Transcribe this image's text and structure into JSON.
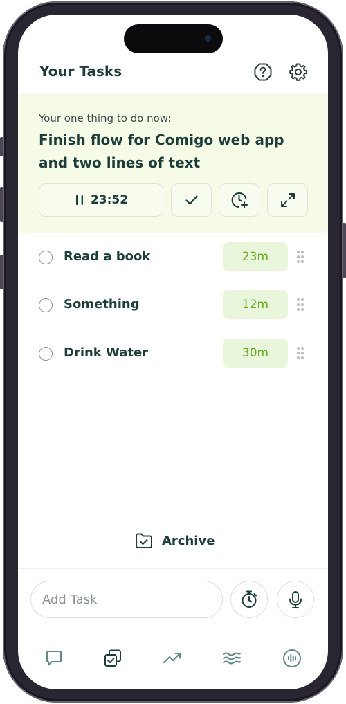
{
  "header": {
    "title": "Your Tasks"
  },
  "focus": {
    "label": "Your one thing to do now:",
    "title": "Finish flow for Comigo web app and two lines of text",
    "timer": "23:52"
  },
  "tasks": [
    {
      "label": "Read a book",
      "duration": "23m"
    },
    {
      "label": "Something",
      "duration": "12m"
    },
    {
      "label": "Drink Water",
      "duration": "30m"
    }
  ],
  "archive": {
    "label": "Archive"
  },
  "add_task": {
    "placeholder": "Add Task"
  },
  "colors": {
    "accent": "#63ab19",
    "text": "#1e3d3a",
    "focus_bg": "#f5fbe6",
    "duration_bg": "#eaf6dc"
  },
  "icons": {
    "header": [
      "help-icon",
      "gear-icon"
    ],
    "focus": [
      "pause-icon",
      "check-icon",
      "clock-plus-icon",
      "expand-icon"
    ],
    "bottom": [
      "stopwatch-icon",
      "microphone-icon"
    ],
    "nav": [
      "chat-icon",
      "tasks-icon",
      "trend-icon",
      "waves-icon",
      "audio-icon"
    ]
  }
}
